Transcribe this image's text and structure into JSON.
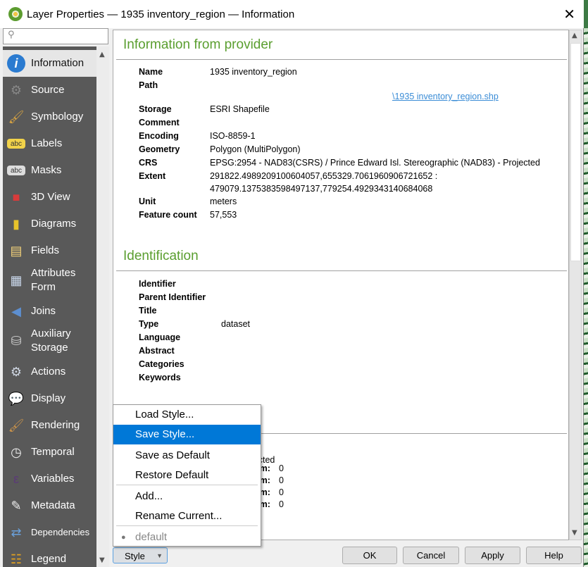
{
  "window": {
    "title": "Layer Properties — 1935 inventory_region — Information",
    "close_icon": "close-icon"
  },
  "search": {
    "placeholder": "",
    "icon": "search-icon"
  },
  "sidebar": {
    "items": [
      {
        "label": "Information",
        "icon": "info-icon",
        "selected": true
      },
      {
        "label": "Source",
        "icon": "source-icon"
      },
      {
        "label": "Symbology",
        "icon": "symbology-icon"
      },
      {
        "label": "Labels",
        "icon": "labels-icon"
      },
      {
        "label": "Masks",
        "icon": "masks-icon"
      },
      {
        "label": "3D View",
        "icon": "cube-icon"
      },
      {
        "label": "Diagrams",
        "icon": "diagrams-icon"
      },
      {
        "label": "Fields",
        "icon": "fields-icon"
      },
      {
        "label": "Attributes\nForm",
        "icon": "form-icon"
      },
      {
        "label": "Joins",
        "icon": "joins-icon"
      },
      {
        "label": "Auxiliary\nStorage",
        "icon": "storage-icon"
      },
      {
        "label": "Actions",
        "icon": "actions-icon"
      },
      {
        "label": "Display",
        "icon": "display-icon"
      },
      {
        "label": "Rendering",
        "icon": "brush-icon"
      },
      {
        "label": "Temporal",
        "icon": "clock-icon"
      },
      {
        "label": "Variables",
        "icon": "epsilon-icon"
      },
      {
        "label": "Metadata",
        "icon": "metadata-icon"
      },
      {
        "label": "Dependencies",
        "icon": "dependencies-icon"
      },
      {
        "label": "Legend",
        "icon": "legend-icon"
      }
    ]
  },
  "provider": {
    "heading": "Information from provider",
    "rows": [
      {
        "label": "Name",
        "value": "1935 inventory_region"
      },
      {
        "label": "Path",
        "value": ""
      },
      {
        "label": "",
        "value": "\\1935 inventory_region.shp"
      },
      {
        "label": "Storage",
        "value": "ESRI Shapefile"
      },
      {
        "label": "Comment",
        "value": ""
      },
      {
        "label": "Encoding",
        "value": "ISO-8859-1"
      },
      {
        "label": "Geometry",
        "value": "Polygon (MultiPolygon)"
      },
      {
        "label": "CRS",
        "value": "EPSG:2954 - NAD83(CSRS) / Prince Edward Isl. Stereographic (NAD83) - Projected"
      },
      {
        "label": "Extent",
        "value": "291822.4989209100604057,655329.7061960906721652 :"
      },
      {
        "label": "",
        "value": "479079.1375383598497137,779254.4929343140684068"
      },
      {
        "label": "Unit",
        "value": "meters"
      },
      {
        "label": "Feature count",
        "value": "57,553"
      }
    ]
  },
  "identification": {
    "heading": "Identification",
    "rows": [
      {
        "label": "Identifier",
        "value": ""
      },
      {
        "label": "Parent Identifier",
        "value": ""
      },
      {
        "label": "Title",
        "value": ""
      },
      {
        "label": "Type",
        "value": "dataset"
      },
      {
        "label": "Language",
        "value": ""
      },
      {
        "label": "Abstract",
        "value": ""
      },
      {
        "label": "Categories",
        "value": ""
      },
      {
        "label": "Keywords",
        "value": ""
      }
    ]
  },
  "obscured": {
    "line1": "jected",
    "rows": [
      {
        "label": "um:",
        "value": "0"
      },
      {
        "label": "um:",
        "value": "0"
      },
      {
        "label": "um:",
        "value": "0"
      },
      {
        "label": "um:",
        "value": "0"
      }
    ]
  },
  "style_menu": {
    "items": [
      "Load Style...",
      "Save Style...",
      "Save as Default",
      "Restore Default",
      "Add...",
      "Rename Current..."
    ],
    "highlighted": "Save Style...",
    "current_style": "default"
  },
  "buttons": {
    "style": "Style",
    "ok": "OK",
    "cancel": "Cancel",
    "apply": "Apply",
    "help": "Help"
  },
  "colors": {
    "heading": "#5a9e2f",
    "highlight": "#0078d7",
    "sidebar": "#595959",
    "link": "#3a8cd6"
  }
}
